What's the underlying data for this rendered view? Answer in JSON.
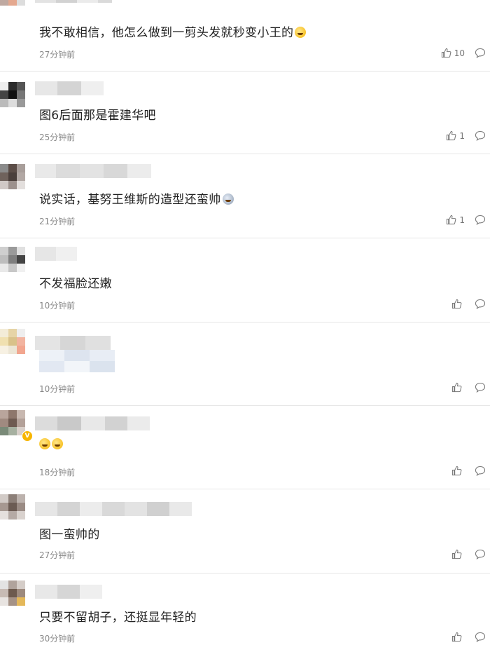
{
  "comments": [
    {
      "text": "我不敢相信，他怎么做到一剪头发就秒变小王的",
      "emoji": "laugh",
      "time": "27分钟前",
      "likes": "10"
    },
    {
      "text": "图6后面那是霍建华吧",
      "emoji": "",
      "time": "25分钟前",
      "likes": "1"
    },
    {
      "text": "说实话，基努王维斯的造型还蛮帅",
      "emoji": "dark",
      "time": "21分钟前",
      "likes": "1"
    },
    {
      "text": "不发福脸还嫩",
      "emoji": "",
      "time": "10分钟前",
      "likes": ""
    },
    {
      "text": "",
      "emoji": "",
      "time": "10分钟前",
      "likes": ""
    },
    {
      "text": "",
      "emoji": "laugh2",
      "time": "18分钟前",
      "likes": ""
    },
    {
      "text": "图一蛮帅的",
      "emoji": "",
      "time": "27分钟前",
      "likes": ""
    },
    {
      "text": "只要不留胡子，还挺显年轻的",
      "emoji": "",
      "time": "30分钟前",
      "likes": ""
    }
  ],
  "icons": {
    "like": "thumbs-up-icon",
    "reply": "comment-bubble-icon",
    "verified": "verified-badge-icon"
  },
  "colors": {
    "text": "#222222",
    "meta": "#888888",
    "divider": "#e6e6e6",
    "verified": "#f7b500"
  }
}
